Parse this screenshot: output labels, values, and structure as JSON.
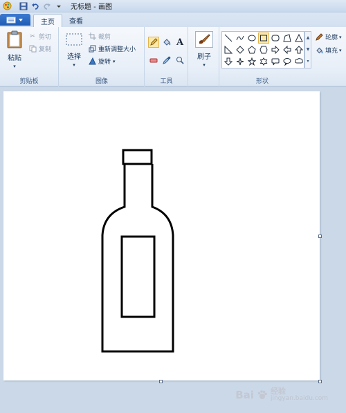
{
  "window": {
    "title": "无标题 - 画图"
  },
  "tabs": [
    {
      "label": "主页",
      "active": true
    },
    {
      "label": "查看",
      "active": false
    }
  ],
  "ribbon": {
    "clipboard": {
      "paste": "粘贴",
      "cut": "剪切",
      "copy": "复制",
      "group": "剪贴板"
    },
    "image": {
      "select": "选择",
      "crop": "裁剪",
      "resize": "重新调整大小",
      "rotate": "旋转",
      "group": "图像"
    },
    "tools": {
      "group": "工具"
    },
    "brushes": {
      "label": "刷子"
    },
    "shapes": {
      "outline": "轮廓",
      "fill": "填充",
      "group": "形状"
    }
  },
  "watermark": {
    "brand": "Bai",
    "brand2": "经验",
    "url": "jingyan.baidu.com"
  },
  "colors": {
    "accent": "#1e5bb5",
    "ribbon_bg": "#e8eff8",
    "workspace": "#cbd8e8",
    "selected_shape": "#fde9a8"
  }
}
